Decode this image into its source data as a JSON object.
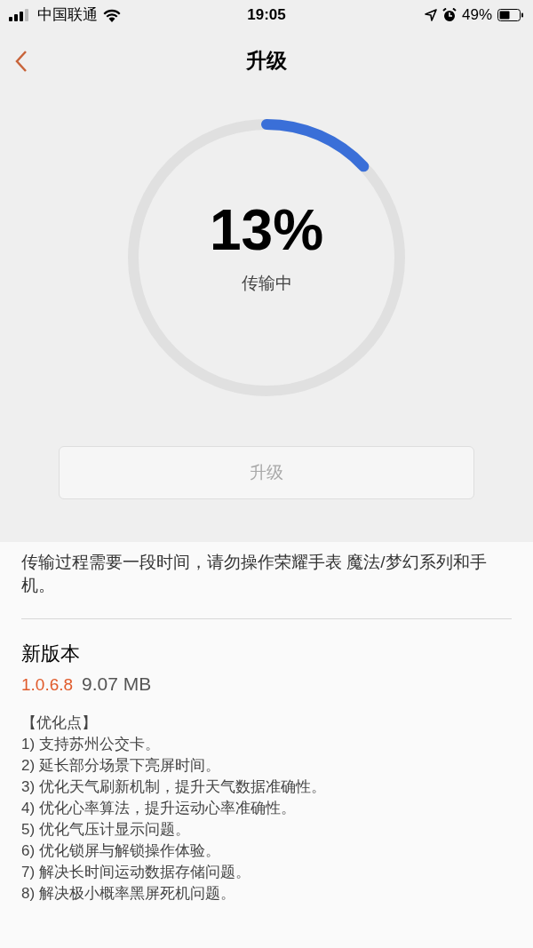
{
  "status_bar": {
    "carrier": "中国联通",
    "time": "19:05",
    "battery_text": "49%"
  },
  "header": {
    "title": "升级"
  },
  "progress": {
    "percent": "13%",
    "status": "传输中"
  },
  "upgrade_button": {
    "label": "升级",
    "disabled": true
  },
  "notice": "传输过程需要一段时间，请勿操作荣耀手表 魔法/梦幻系列和手机。",
  "new_version": {
    "heading": "新版本",
    "version": "1.0.6.8",
    "size": "9.07 MB"
  },
  "changelog": [
    "【优化点】",
    "1) 支持苏州公交卡。",
    "2) 延长部分场景下亮屏时间。",
    "3) 优化天气刷新机制，提升天气数据准确性。",
    "4) 优化心率算法，提升运动心率准确性。",
    "5) 优化气压计显示问题。",
    "6) 优化锁屏与解锁操作体验。",
    "7) 解决长时间运动数据存储问题。",
    "8) 解决极小概率黑屏死机问题。"
  ]
}
